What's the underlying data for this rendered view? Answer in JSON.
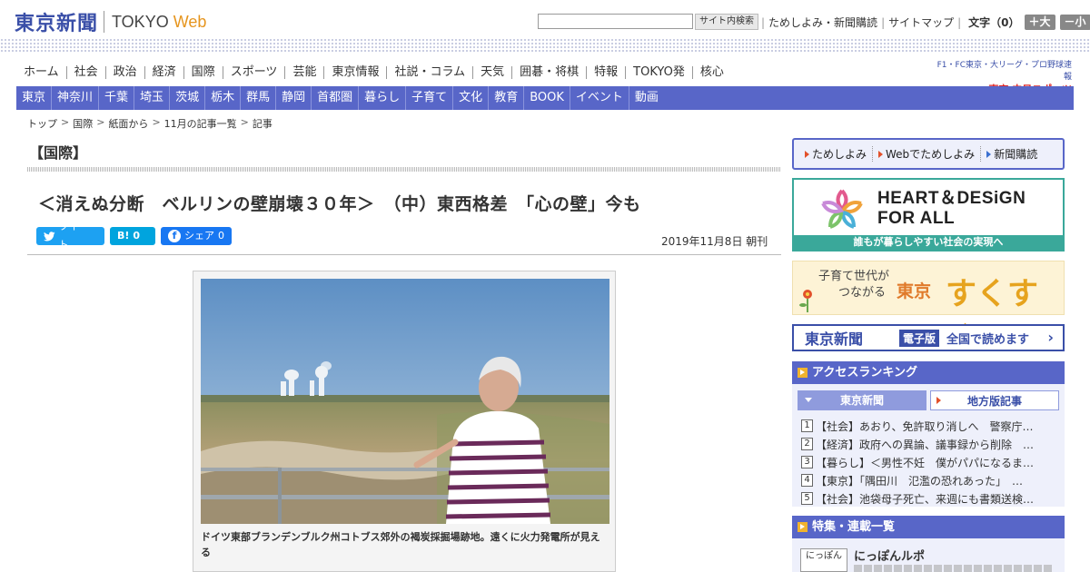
{
  "header": {
    "logo_ja": "東京新聞",
    "logo_tokyo": "TOKYO",
    "logo_web": "Web",
    "search_button": "サイト内検索",
    "links": [
      "ためしよみ・新聞購読",
      "サイトマップ"
    ],
    "text_size_label": "文字（0）",
    "size_up": "＋大",
    "size_down": "－小"
  },
  "nav_main": [
    "ホーム",
    "社会",
    "政治",
    "経済",
    "国際",
    "スポーツ",
    "芸能",
    "東京情報",
    "社説・コラム",
    "天気",
    "囲碁・将棋",
    "特報",
    "TOKYO発",
    "核心"
  ],
  "chunichi": {
    "line1": "F1・FC東京・大リーグ・プロ野球速報",
    "line2_prefix": "東京",
    "line2_main": "中日スポーツ"
  },
  "nav_sub": [
    "東京",
    "神奈川",
    "千葉",
    "埼玉",
    "茨城",
    "栃木",
    "群馬",
    "静岡",
    "首都圏",
    "暮らし",
    "子育て",
    "文化",
    "教育",
    "BOOK",
    "イベント",
    "動画"
  ],
  "breadcrumb": [
    "トップ",
    "国際",
    "紙面から",
    "11月の記事一覧",
    "記事"
  ],
  "section_title": "【国際】",
  "article": {
    "title": "＜消えぬ分断　ベルリンの壁崩壊３０年＞　（中）東西格差　「心の壁」今も",
    "date": "2019年11月8日 朝刊",
    "caption": "ドイツ東部ブランデンブルク州コトブス郊外の褐炭採掘場跡地。遠くに火力発電所が見える"
  },
  "social": {
    "tweet": "ツイート",
    "hatena_label": "B!",
    "hatena_count": "0",
    "share": "シェア",
    "share_count": "0"
  },
  "sidebar": {
    "tameshi": [
      "ためしよみ",
      "Webでためしよみ",
      "新聞購読"
    ],
    "heart_design_line1": "HEART＆DESiGN",
    "heart_design_line2": "FOR ALL",
    "heart_design_foot": "誰もが暮らしやすい社会の実現へ",
    "sukusuku_line1": "子育て世代が",
    "sukusuku_line2": "つながる",
    "sukusuku_tokyo": "東京",
    "sukusuku_big": "すくすく",
    "denshi_logo": "東京新聞",
    "denshi_badge": "電子版",
    "denshi_text": "全国で読めます",
    "denshi_arrow": "›",
    "ranking_head": "アクセスランキング",
    "ranking_tabs": [
      "東京新聞",
      "地方版記事"
    ],
    "ranking": [
      {
        "num": "1",
        "text": "【社会】あおり、免許取り消しへ　警察庁…"
      },
      {
        "num": "2",
        "text": "【経済】政府への異論、議事録から削除　…"
      },
      {
        "num": "3",
        "text": "【暮らし】＜男性不妊　僕がパパになるま…"
      },
      {
        "num": "4",
        "text": "【東京】「隅田川　氾濫の恐れあった」　…"
      },
      {
        "num": "5",
        "text": "【社会】池袋母子死亡、来週にも書類送検…"
      }
    ],
    "feature_head": "特集・連載一覧",
    "feature_thumb": "にっぽん",
    "feature_title": "にっぽんルポ"
  },
  "colors": {
    "brand": "#3a4fa8",
    "nav_sub_bg": "#5866c8",
    "accent_orange": "#e6951e",
    "heart_green": "#3aa89a"
  }
}
